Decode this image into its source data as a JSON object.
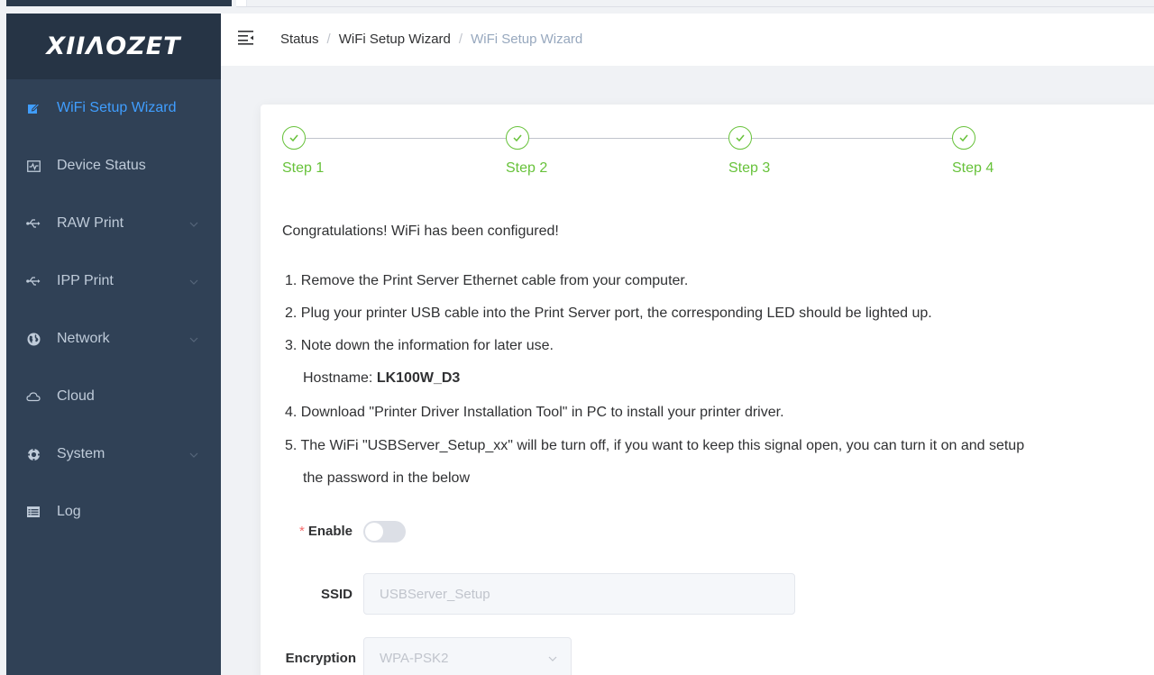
{
  "brand": {
    "logo_text": "XIIΛOZET"
  },
  "colors": {
    "accent": "#409eff",
    "success": "#67c23a",
    "sidebar_bg": "#304156",
    "required": "#f56c6c"
  },
  "sidebar": {
    "items": [
      {
        "label": "WiFi Setup Wizard",
        "icon": "edit-icon",
        "active": true
      },
      {
        "label": "Device Status",
        "icon": "monitor-icon",
        "active": false
      },
      {
        "label": "RAW Print",
        "icon": "usb-icon",
        "expandable": true
      },
      {
        "label": "IPP Print",
        "icon": "usb-icon",
        "expandable": true
      },
      {
        "label": "Network",
        "icon": "globe-icon",
        "expandable": true
      },
      {
        "label": "Cloud",
        "icon": "cloud-icon"
      },
      {
        "label": "System",
        "icon": "gear-icon",
        "expandable": true
      },
      {
        "label": "Log",
        "icon": "list-icon"
      }
    ]
  },
  "breadcrumb": {
    "items": [
      "Status",
      "WiFi Setup Wizard",
      "WiFi Setup Wizard"
    ],
    "separator": "/"
  },
  "steps": [
    {
      "label": "Step 1",
      "status": "finished"
    },
    {
      "label": "Step 2",
      "status": "finished"
    },
    {
      "label": "Step 3",
      "status": "finished"
    },
    {
      "label": "Step 4",
      "status": "finished"
    }
  ],
  "content": {
    "congrats": "Congratulations! WiFi has been configured!",
    "instructions": [
      "1. Remove the Print Server Ethernet cable from your computer.",
      "2. Plug your printer USB cable into the Print Server port, the corresponding LED should be lighted up.",
      "3. Note down the information for later use.",
      "4. Download \"Printer Driver Installation Tool\" in PC to install your printer driver.",
      "5. The WiFi \"USBServer_Setup_xx\" will be turn off, if you want to keep this signal open, you can turn it on and setup",
      "the password in the below"
    ],
    "hostname_label": "Hostname: ",
    "hostname_value": "LK100W_D3"
  },
  "form": {
    "enable_label": "Enable",
    "required_mark": "*",
    "enable_value": false,
    "ssid_label": "SSID",
    "ssid_value": "USBServer_Setup",
    "encryption_label": "Encryption",
    "encryption_value": "WPA-PSK2"
  }
}
